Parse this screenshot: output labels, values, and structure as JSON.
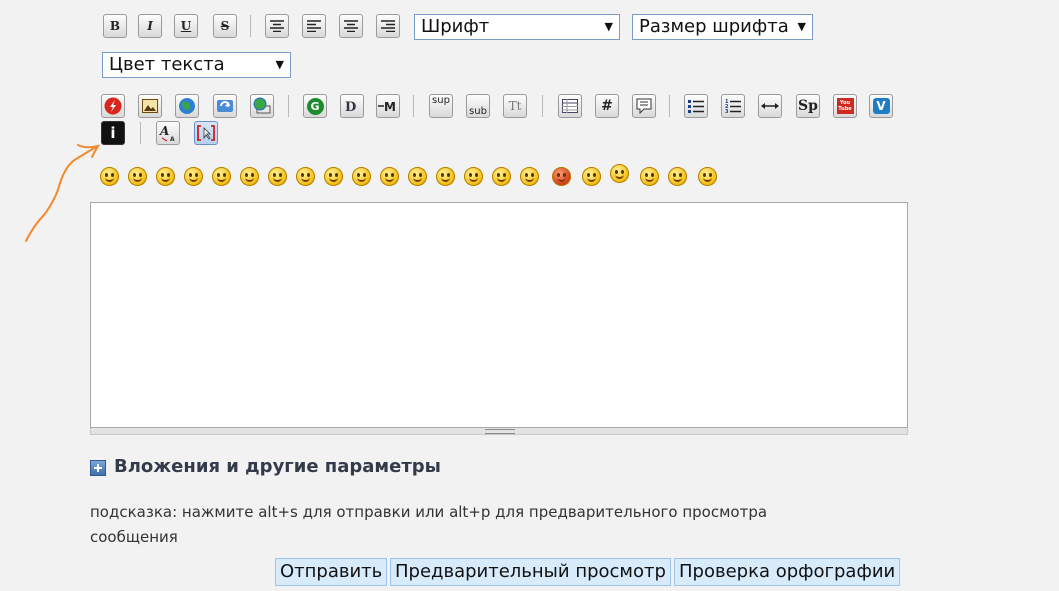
{
  "toolbar": {
    "bold": "B",
    "italic": "I",
    "underline": "U",
    "strike": "S",
    "font_select": "Шрифт",
    "size_select": "Размер шрифта",
    "color_select": "Цвет текста",
    "google": "G",
    "sup": "sup",
    "sub": "sub",
    "tt": "Tt",
    "hash": "#",
    "sp": "Sp",
    "youtube": "You Tube",
    "vimeo": "V",
    "info": "i",
    "arrow_symbol": "▼"
  },
  "attachments": {
    "title": "Вложения и другие параметры"
  },
  "hint": {
    "text": "подсказка: нажмите alt+s для отправки или alt+p для предварительного просмотра сообщения"
  },
  "buttons": {
    "submit": "Отправить",
    "preview": "Предварительный просмотр",
    "spell": "Проверка орфографии"
  },
  "colors": {
    "annotation": "#f28a2e",
    "title": "#333a4a"
  }
}
